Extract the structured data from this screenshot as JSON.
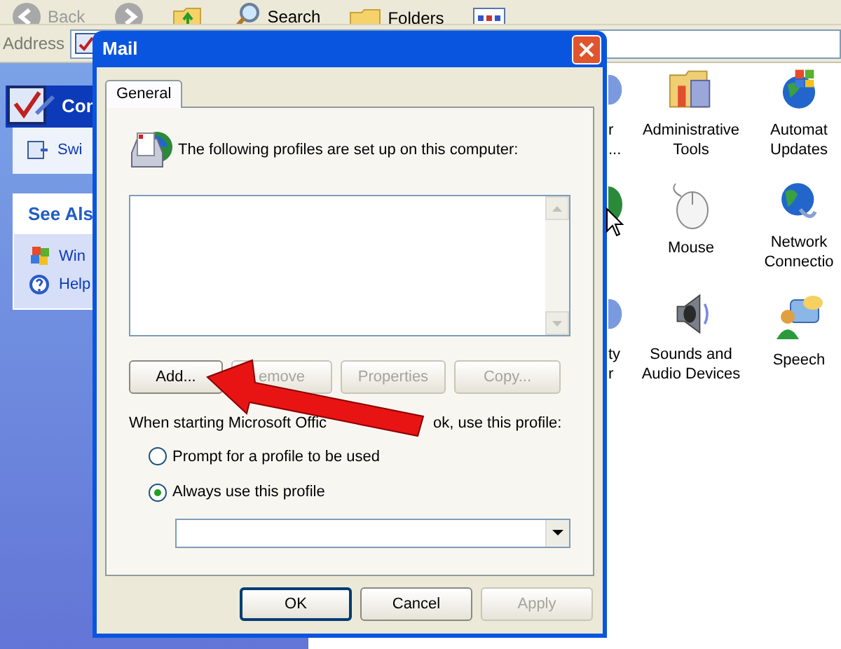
{
  "explorer": {
    "toolbar": [
      {
        "label": "Back",
        "kind": "back",
        "disabled": true
      },
      {
        "kind": "forward",
        "disabled": true
      },
      {
        "kind": "up"
      },
      {
        "label": "Search",
        "kind": "search"
      },
      {
        "label": "Folders",
        "kind": "folders"
      },
      {
        "kind": "views"
      }
    ],
    "address_label": "Address",
    "sidebar": {
      "header": "Con",
      "tasks": [
        "Swi"
      ],
      "see_also": {
        "title": "See Als",
        "items": [
          {
            "label": "Win",
            "kind": "windows"
          },
          {
            "label": "Help",
            "kind": "help"
          }
        ]
      }
    },
    "icons": [
      [
        {
          "lines": [
            "r",
            "..."
          ],
          "kind": "fragment"
        },
        {
          "kind": "green"
        },
        {
          "lines": [
            "ty",
            "r"
          ],
          "kind": "fragment"
        }
      ],
      [
        {
          "lines": [
            "Administrative",
            "Tools"
          ],
          "kind": "admin"
        },
        {
          "lines": [
            "Mouse"
          ],
          "kind": "mouse"
        },
        {
          "lines": [
            "Sounds and",
            "Audio Devices"
          ],
          "kind": "sound"
        }
      ],
      [
        {
          "lines": [
            "Automat",
            "Updates"
          ],
          "kind": "updates"
        },
        {
          "lines": [
            "Network",
            "Connectio"
          ],
          "kind": "network"
        },
        {
          "lines": [
            "Speech"
          ],
          "kind": "speech"
        }
      ]
    ]
  },
  "dialog": {
    "title": "Mail",
    "tabs": [
      {
        "label": "General",
        "selected": true
      }
    ],
    "intro": "The following profiles are set up on this computer:",
    "profile_buttons": [
      {
        "label": "Add...",
        "disabled": false
      },
      {
        "label": "emove",
        "disabled": true
      },
      {
        "label": "Properties",
        "disabled": true
      },
      {
        "label": "Copy...",
        "disabled": true
      }
    ],
    "startup_text": [
      "When starting Microsoft Offic",
      "ok, use this profile:"
    ],
    "options": [
      {
        "label": "Prompt for a profile to be used",
        "selected": false
      },
      {
        "label": "Always use this profile",
        "selected": true
      }
    ],
    "footer_buttons": [
      {
        "label": "OK",
        "disabled": false,
        "default": true
      },
      {
        "label": "Cancel",
        "disabled": false,
        "default": false
      },
      {
        "label": "Apply",
        "disabled": true,
        "default": false
      }
    ]
  }
}
